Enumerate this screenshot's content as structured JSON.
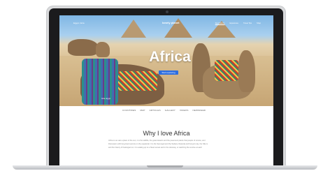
{
  "site": {
    "logo_text": "lonely planet",
    "location_text": "Egypt, Giza",
    "nav": [
      "Destinations",
      "Experience",
      "Travel Tips",
      "Shop"
    ]
  },
  "hero": {
    "title": "Africa",
    "cta_label": "Start exploring",
    "caption": "Giza, Egypt"
  },
  "subnav": [
    "COUNTRIES",
    "MAP",
    "ARTICLES",
    "GALLERY",
    "VIDEOS",
    "NEWSFEED"
  ],
  "content": {
    "heading": "Why I love Africa",
    "paragraph_line_1": "Africa is as vast a place of the sun, it is the wildlife, the great deserts and the pavement plants that people of remote, and",
    "paragraph_line_2": "Discussion with long-lived secrets on the equatorial. It is the Serengeti and the Sahara, Rwanda and Kenya's sky, the Nile is",
    "paragraph_line_3": "and the history of Kaisingani on. It is waking up to a Steel sunset and in the doorway, or watching the sunrise at each"
  }
}
